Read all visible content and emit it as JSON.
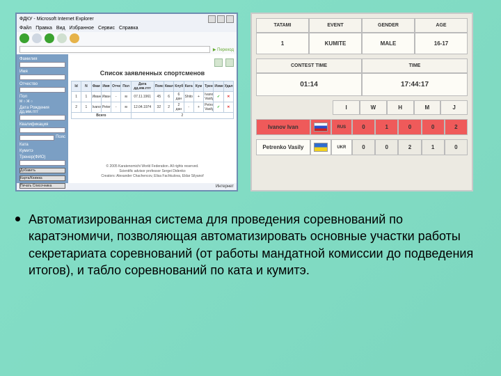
{
  "shot1": {
    "windowTitle": "ФДКУ - Microsoft Internet Explorer",
    "menu": [
      "Файл",
      "Правка",
      "Вид",
      "Избранное",
      "Сервис",
      "Справка"
    ],
    "addressBar": "",
    "sidebar": {
      "fields": [
        "Фамилия",
        "Имя",
        "Отчество",
        "Пол",
        "Дата Рождения дд.мм.гггг"
      ],
      "gender": [
        "М",
        "Ж"
      ],
      "groups": [
        "Квалификация",
        "Пояс",
        "Ката",
        "Кумитэ",
        "Тренер(ФИО)"
      ],
      "buttons": [
        "Добавить",
        "Карта/Книжка",
        "Печать Списочника"
      ]
    },
    "pageTitle": "Список заявленных спортсменов",
    "table": {
      "headers": [
        "Id",
        "N",
        "Фам",
        "Имя",
        "Отчес",
        "Пол",
        "Дата дд.мм.гггг",
        "Пояс",
        "Квал",
        "Клуб",
        "Ката",
        "Кум",
        "Тренер",
        "Изменить",
        "Удалить"
      ],
      "rows": [
        {
          "id": "1",
          "n": "1",
          "f": "Иванов",
          "i": "Иван",
          "o": "-",
          "p": "м",
          "d": "07.11.1961",
          "b": "45",
          "k": "6",
          "cl": "6 дан",
          "ka": "Shito",
          "ku": "+",
          "tr": "Ivanov Vasily",
          "e": "✓",
          "x": "✕"
        },
        {
          "id": "2",
          "n": "1",
          "f": "Ivanov",
          "i": "Peter",
          "o": "-",
          "p": "м",
          "d": "12.04.1974",
          "b": "32",
          "k": "2",
          "cl": "2 дан",
          "ka": "-",
          "ku": "+",
          "tr": "Petrov Vasily",
          "e": "✓",
          "x": "✕"
        }
      ],
      "total": {
        "label": "Всего",
        "value": "2"
      }
    },
    "footer": {
      "l1": "© 2005 Karatenomichi World Federation. All rights reserved.",
      "l2": "Scientific advisor professor Sergei Didenko",
      "l3": "Creators: Alexander Chachencov, Elisa Fachkulova, Eldar Silyanof"
    },
    "status": {
      "left": "",
      "right": "Интернет"
    }
  },
  "shot2": {
    "hdr": [
      "TATAMI",
      "EVENT",
      "GENDER",
      "AGE"
    ],
    "hdrVals": [
      "1",
      "KUMITE",
      "MALE",
      "16-17"
    ],
    "timeHdr": [
      "CONTEST TIME",
      "TIME"
    ],
    "timeVals": [
      "01:14",
      "17:44:17"
    ],
    "scoreHdr": [
      "I",
      "W",
      "H",
      "M",
      "J"
    ],
    "ath1": {
      "name": "Ivanov Ivan",
      "cc": "RUS",
      "scores": [
        "0",
        "1",
        "0",
        "0",
        "2"
      ]
    },
    "ath2": {
      "name": "Petrenko Vasily",
      "cc": "UKR",
      "scores": [
        "0",
        "0",
        "2",
        "1",
        "0"
      ]
    }
  },
  "bullet": "Автоматизированная система для проведения соревнований по каратэномичи, позволяющая автоматизировать основные участки работы секретариата соревнований (от работы мандатной комиссии до подведения итогов), и табло соревнований по ката и кумитэ."
}
